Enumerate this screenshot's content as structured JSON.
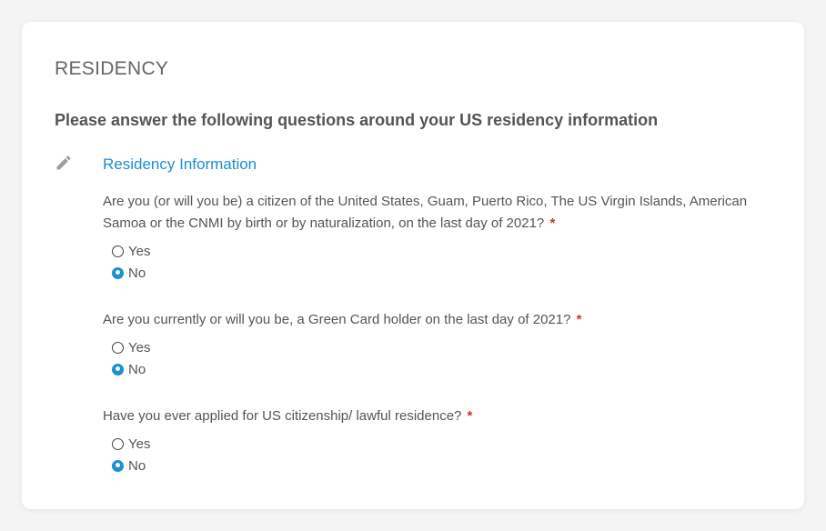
{
  "section": {
    "title": "RESIDENCY",
    "intro": "Please answer the following questions around your US residency information"
  },
  "subsection": {
    "title": "Residency Information"
  },
  "required_marker": "*",
  "questions": [
    {
      "text": "Are you (or will you be) a citizen of the United States, Guam, Puerto Rico, The US Virgin Islands, American Samoa or the CNMI by birth or by naturalization, on the last day of 2021?",
      "options": [
        {
          "label": "Yes",
          "selected": false
        },
        {
          "label": "No",
          "selected": true
        }
      ]
    },
    {
      "text": "Are you currently or will you be, a Green Card holder on the last day of 2021?",
      "options": [
        {
          "label": "Yes",
          "selected": false
        },
        {
          "label": "No",
          "selected": true
        }
      ]
    },
    {
      "text": "Have you ever applied for US citizenship/ lawful residence?",
      "options": [
        {
          "label": "Yes",
          "selected": false
        },
        {
          "label": "No",
          "selected": true
        }
      ]
    }
  ],
  "icons": {
    "edit": "pencil-icon"
  },
  "colors": {
    "accent": "#1a8fd1",
    "required": "#d32f2f",
    "text": "#555555"
  }
}
